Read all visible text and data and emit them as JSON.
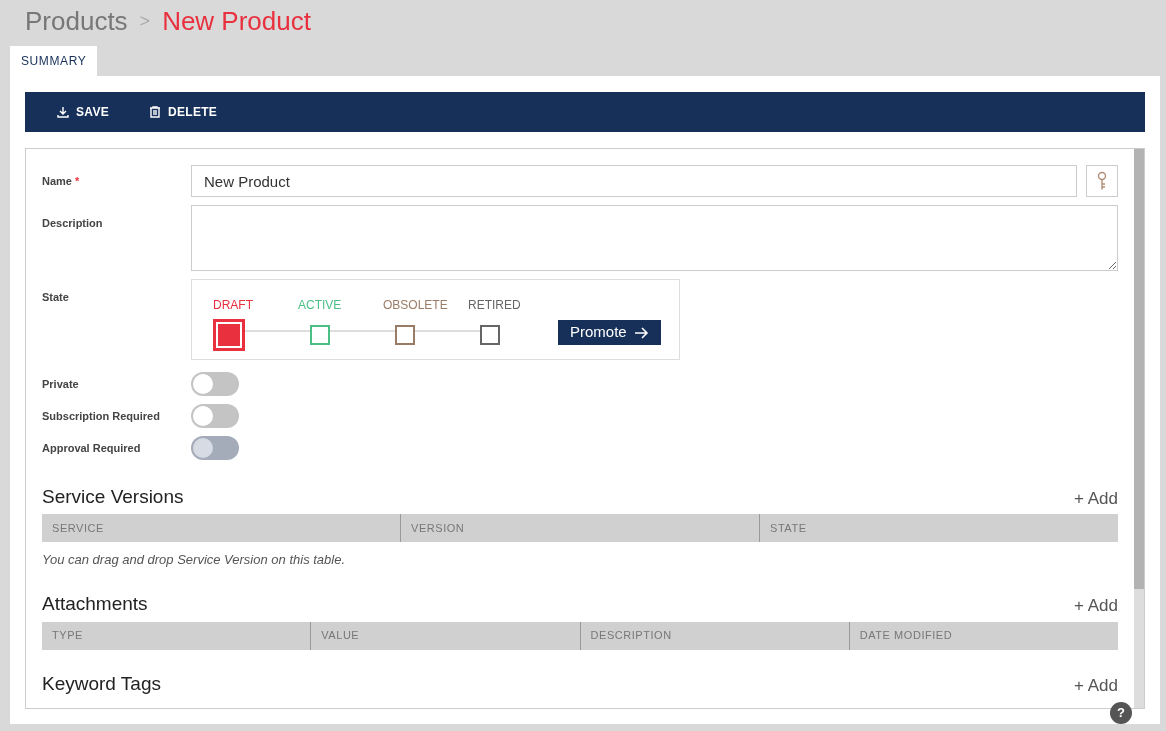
{
  "breadcrumb": {
    "parent": "Products",
    "separator": ">",
    "current": "New Product"
  },
  "tabs": [
    {
      "label": "SUMMARY",
      "selected": true
    }
  ],
  "toolbar": [
    {
      "label": "SAVE",
      "kind": "save"
    },
    {
      "label": "DELETE",
      "kind": "delete"
    }
  ],
  "form": {
    "name": {
      "label": "Name",
      "required_mark": "*",
      "value": "New Product"
    },
    "description": {
      "label": "Description"
    },
    "state": {
      "label": "State",
      "steps": [
        {
          "label": "DRAFT",
          "color": "#e8303e",
          "selected": true
        },
        {
          "label": "ACTIVE",
          "color": "#4cbf86",
          "selected": false
        },
        {
          "label": "OBSOLETE",
          "color": "#9a7b66",
          "selected": false
        },
        {
          "label": "RETIRED",
          "color": "#666666",
          "selected": false
        }
      ],
      "promote_button": "Promote"
    },
    "toggles": [
      {
        "label": "Private",
        "on": false,
        "disabled": false
      },
      {
        "label": "Subscription Required",
        "on": false,
        "disabled": false
      },
      {
        "label": "Approval Required",
        "on": false,
        "disabled": true
      }
    ]
  },
  "sections": [
    {
      "title": "Service Versions",
      "add": "+ Add",
      "columns": [
        "SERVICE",
        "VERSION",
        "STATE"
      ],
      "note": "You can drag and drop Service Version on this table."
    },
    {
      "title": "Attachments",
      "add": "+ Add",
      "columns": [
        "TYPE",
        "VALUE",
        "DESCRIPTION",
        "DATE MODIFIED"
      ]
    },
    {
      "title": "Keyword Tags",
      "add": "+ Add"
    }
  ],
  "help_button": "?"
}
